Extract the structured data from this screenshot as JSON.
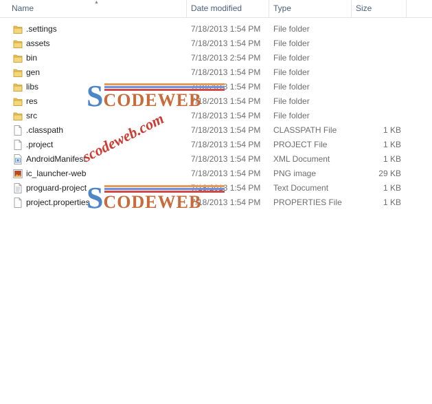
{
  "columns": {
    "name": "Name",
    "date": "Date modified",
    "type": "Type",
    "size": "Size"
  },
  "files": [
    {
      "name": ".settings",
      "date": "7/18/2013 1:54 PM",
      "type": "File folder",
      "size": "",
      "icon": "folder-icon"
    },
    {
      "name": "assets",
      "date": "7/18/2013 1:54 PM",
      "type": "File folder",
      "size": "",
      "icon": "folder-icon"
    },
    {
      "name": "bin",
      "date": "7/18/2013 2:54 PM",
      "type": "File folder",
      "size": "",
      "icon": "folder-icon"
    },
    {
      "name": "gen",
      "date": "7/18/2013 1:54 PM",
      "type": "File folder",
      "size": "",
      "icon": "folder-icon"
    },
    {
      "name": "libs",
      "date": "7/18/2013 1:54 PM",
      "type": "File folder",
      "size": "",
      "icon": "folder-icon"
    },
    {
      "name": "res",
      "date": "7/18/2013 1:54 PM",
      "type": "File folder",
      "size": "",
      "icon": "folder-icon"
    },
    {
      "name": "src",
      "date": "7/18/2013 1:54 PM",
      "type": "File folder",
      "size": "",
      "icon": "folder-icon"
    },
    {
      "name": ".classpath",
      "date": "7/18/2013 1:54 PM",
      "type": "CLASSPATH File",
      "size": "1 KB",
      "icon": "file-icon"
    },
    {
      "name": ".project",
      "date": "7/18/2013 1:54 PM",
      "type": "PROJECT File",
      "size": "1 KB",
      "icon": "file-icon"
    },
    {
      "name": "AndroidManifest",
      "date": "7/18/2013 1:54 PM",
      "type": "XML Document",
      "size": "1 KB",
      "icon": "xml-file-icon"
    },
    {
      "name": "ic_launcher-web",
      "date": "7/18/2013 1:54 PM",
      "type": "PNG image",
      "size": "29 KB",
      "icon": "image-file-icon"
    },
    {
      "name": "proguard-project",
      "date": "7/18/2013 1:54 PM",
      "type": "Text Document",
      "size": "1 KB",
      "icon": "text-file-icon"
    },
    {
      "name": "project.properties",
      "date": "7/18/2013 1:54 PM",
      "type": "PROPERTIES File",
      "size": "1 KB",
      "icon": "file-icon"
    }
  ],
  "watermark": {
    "logo_s": "S",
    "logo_rest": "CODEWEB",
    "url": "scodeweb.com"
  },
  "colors": {
    "header_text": "#4c607a",
    "folder": "#e8c15a",
    "watermark_blue": "#4d86c6",
    "watermark_orange": "#c86a3a",
    "watermark_red": "#cc2a20"
  }
}
